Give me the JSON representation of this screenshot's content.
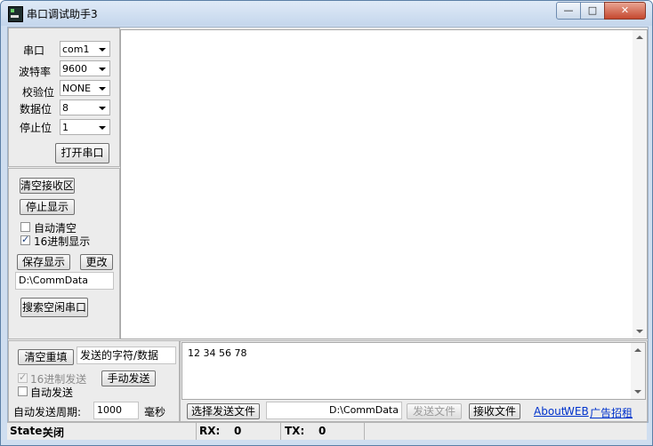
{
  "window": {
    "title": "串口调试助手3",
    "min_glyph": "—",
    "max_glyph": "□",
    "close_glyph": "✕"
  },
  "port_settings": {
    "port_label": "串口",
    "port_value": "com1",
    "baud_label": "波特率",
    "baud_value": "9600",
    "parity_label": "校验位",
    "parity_value": "NONE",
    "databits_label": "数据位",
    "databits_value": "8",
    "stopbits_label": "停止位",
    "stopbits_value": "1",
    "open_button": "打开串口"
  },
  "receive_controls": {
    "clear_button": "清空接收区",
    "stop_button": "停止显示",
    "auto_clear_label": "自动清空",
    "auto_clear_checked": false,
    "hex_display_label": "16进制显示",
    "hex_display_checked": true,
    "save_button": "保存显示",
    "change_button": "更改",
    "path_value": "D:\\CommData",
    "search_button": "搜索空闲串口"
  },
  "send_controls": {
    "clear_resend_button": "清空重填",
    "send_hint": "发送的字符/数据",
    "hex_send_label": "16进制发送",
    "hex_send_checked": true,
    "manual_send_button": "手动发送",
    "auto_send_label": "自动发送",
    "auto_send_checked": false,
    "period_label": "自动发送周期:",
    "period_value": "1000",
    "period_unit": "毫秒",
    "send_text": "12 34 56 78",
    "select_file_button": "选择发送文件",
    "file_path": "D:\\CommData",
    "send_file_button": "发送文件",
    "receive_file_button": "接收文件",
    "about_link": "About",
    "web_link": "WEB",
    "ad_link": "广告招租"
  },
  "status_bar": {
    "state_label": "State:",
    "state_value": "关闭",
    "rx_label": "RX:",
    "rx_value": "0",
    "tx_label": "TX:",
    "tx_value": "0"
  },
  "colors": {
    "window_frame": "#cfdef0",
    "panel": "#ececec",
    "link": "#0033cc",
    "close_button": "#c5482f"
  }
}
